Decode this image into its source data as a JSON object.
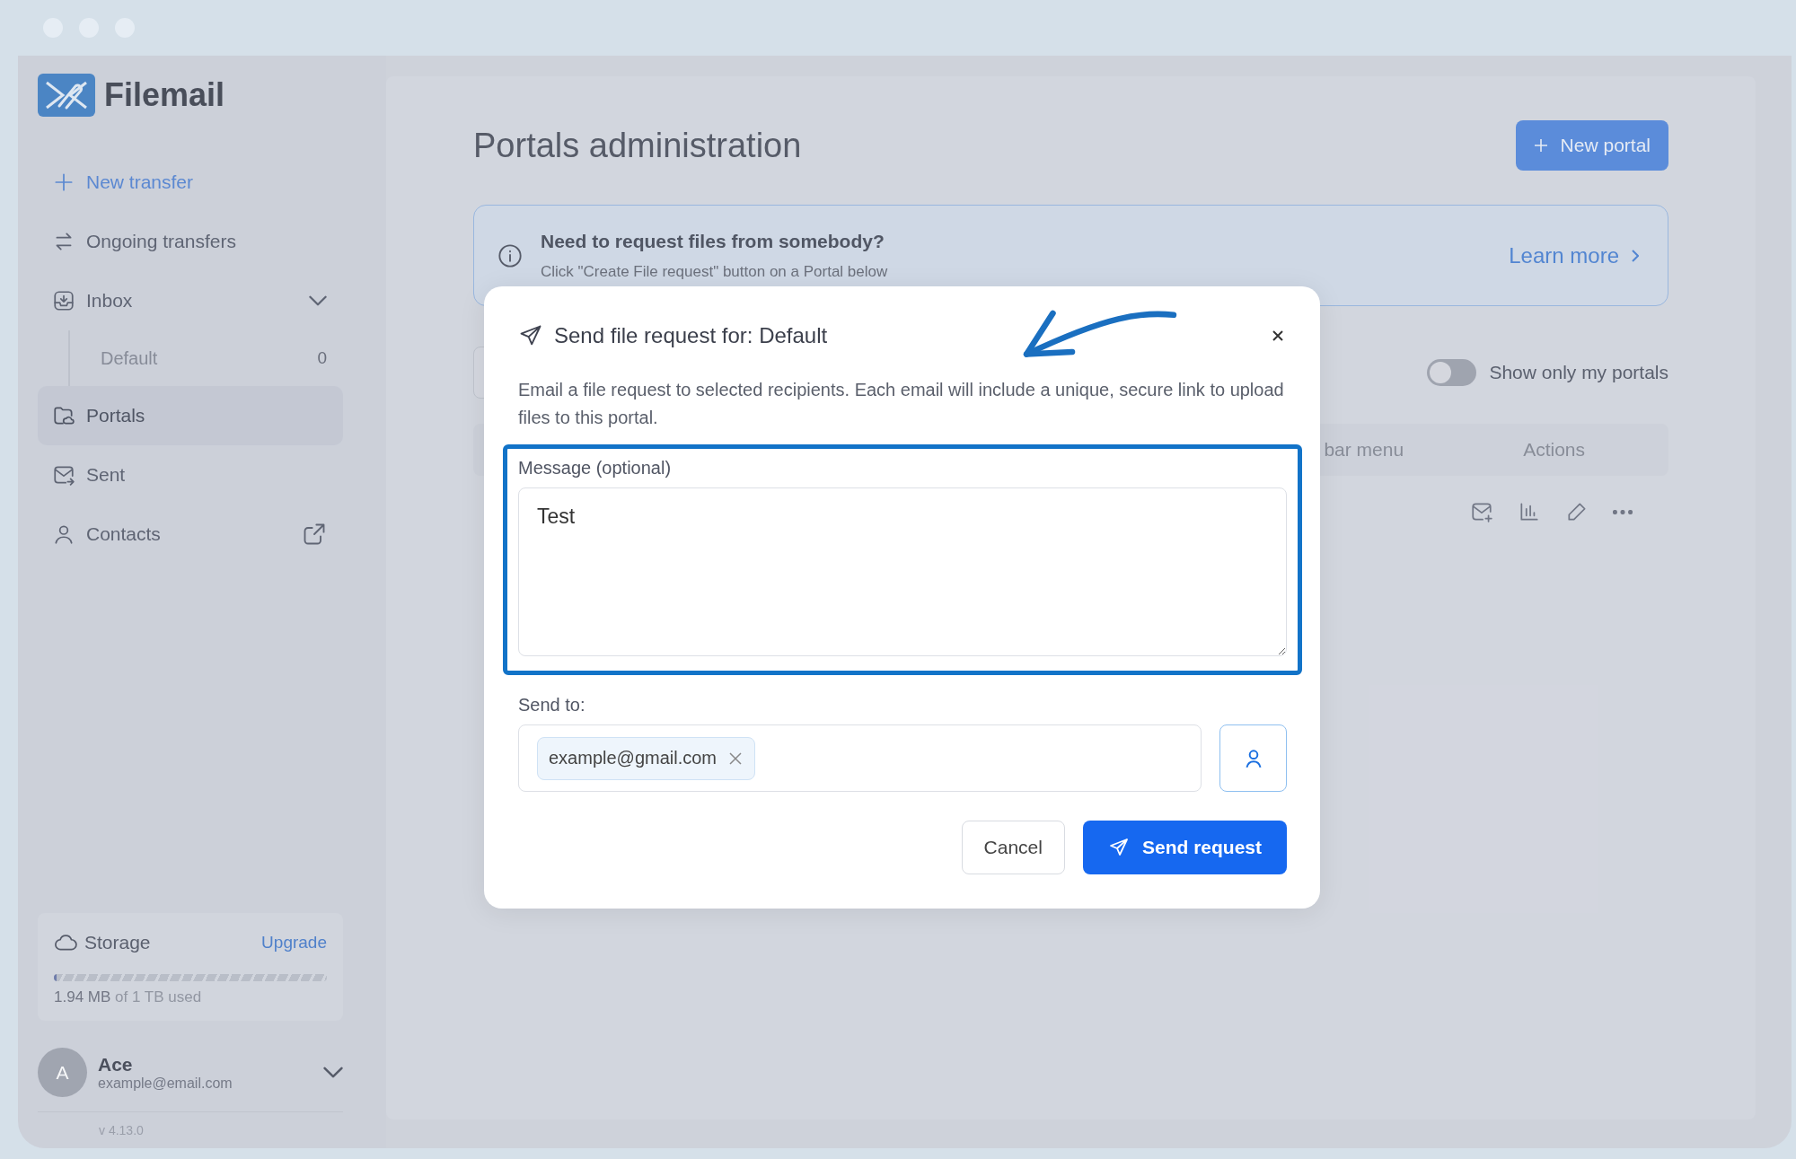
{
  "app": {
    "name": "Filemail"
  },
  "sidebar": {
    "items": [
      {
        "label": "New transfer",
        "kind": "action"
      },
      {
        "label": "Ongoing transfers",
        "selected": false,
        "kind": "link"
      },
      {
        "label": "Inbox",
        "selected": false,
        "kind": "group",
        "expanded": true,
        "children": [
          {
            "label": "Default",
            "count": "0",
            "selected": false
          }
        ]
      },
      {
        "label": "Portals",
        "selected": true,
        "kind": "link"
      },
      {
        "label": "Sent",
        "selected": false,
        "kind": "link"
      },
      {
        "label": "Contacts",
        "selected": false,
        "kind": "external"
      }
    ],
    "storage": {
      "title": "Storage",
      "upgrade": "Upgrade",
      "level": 0.01,
      "used": "1.94 MB",
      "total": "of 1 TB used"
    },
    "user": {
      "initial": "A",
      "name": "Ace",
      "email": "example@email.com"
    },
    "version": "v 4.13.0"
  },
  "main": {
    "title": "Portals administration",
    "new_button": "New portal",
    "banner": {
      "title": "Need to request files from somebody?",
      "text": "Click \"Create File request\" button on a Portal below",
      "link": "Learn more"
    },
    "toggle": {
      "label": "Show only my portals",
      "on": false
    },
    "table": {
      "columns": [
        "bar menu",
        "Actions"
      ]
    }
  },
  "dialog": {
    "title": "Send file request for: Default",
    "description": "Email a file request to selected recipients. Each email will include a unique, secure link to upload files to this portal.",
    "message": {
      "label": "Message (optional)",
      "value": "Test"
    },
    "send_to": {
      "label": "Send to:",
      "recipients": [
        "example@gmail.com"
      ]
    },
    "cancel": "Cancel",
    "submit": "Send request"
  }
}
